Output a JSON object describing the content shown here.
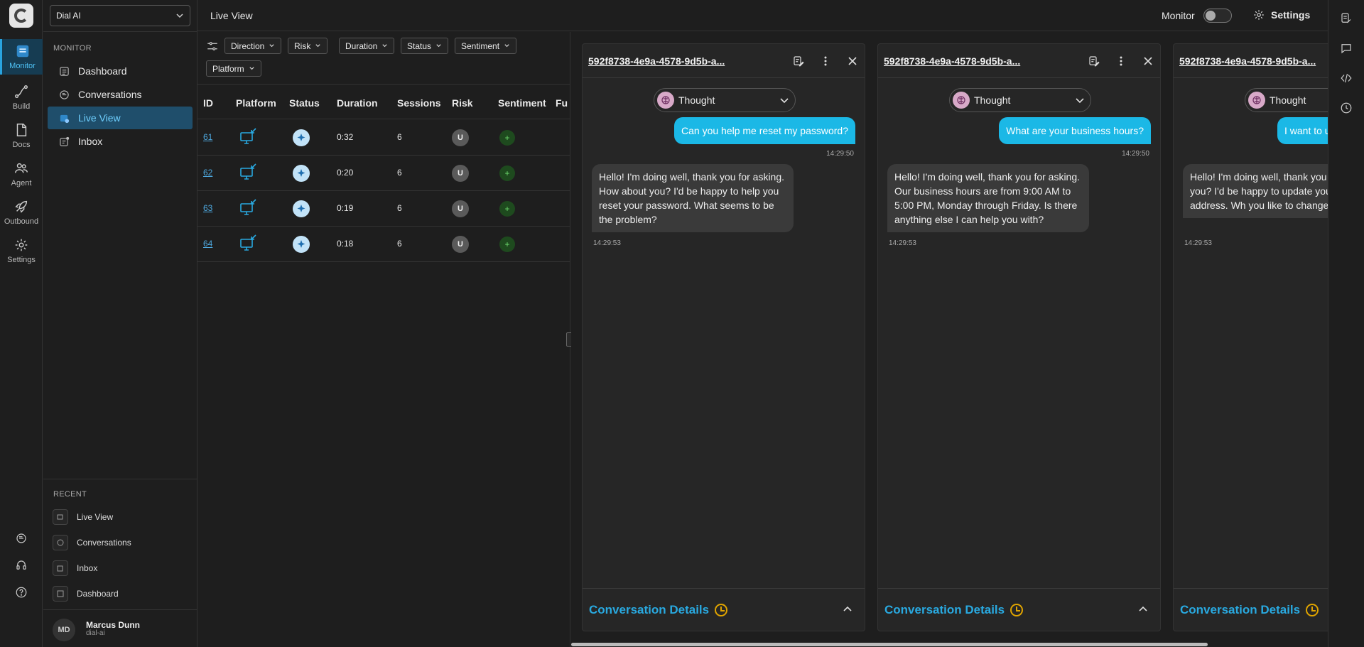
{
  "app": {
    "org": "Dial AI"
  },
  "rail": {
    "items": [
      {
        "label": "Monitor"
      },
      {
        "label": "Build"
      },
      {
        "label": "Docs"
      },
      {
        "label": "Agent"
      },
      {
        "label": "Outbound"
      },
      {
        "label": "Settings"
      }
    ]
  },
  "sidebar": {
    "section": "MONITOR",
    "items": [
      {
        "label": "Dashboard"
      },
      {
        "label": "Conversations"
      },
      {
        "label": "Live View"
      },
      {
        "label": "Inbox"
      }
    ],
    "recent_label": "RECENT",
    "recent": [
      {
        "label": "Live View"
      },
      {
        "label": "Conversations"
      },
      {
        "label": "Inbox"
      },
      {
        "label": "Dashboard"
      }
    ]
  },
  "user": {
    "initials": "MD",
    "name": "Marcus Dunn",
    "org": "dial-ai"
  },
  "header": {
    "title": "Live View",
    "monitor_label": "Monitor",
    "settings_label": "Settings"
  },
  "filters": [
    "Direction",
    "Risk",
    "Duration",
    "Status",
    "Sentiment",
    "Platform"
  ],
  "table": {
    "columns": [
      "ID",
      "Platform",
      "Status",
      "Duration",
      "Sessions",
      "Risk",
      "Sentiment",
      "Fu"
    ],
    "rows": [
      {
        "id": "61",
        "duration": "0:32",
        "sessions": "6",
        "risk": "U",
        "sentiment": "+"
      },
      {
        "id": "62",
        "duration": "0:20",
        "sessions": "6",
        "risk": "U",
        "sentiment": "+"
      },
      {
        "id": "63",
        "duration": "0:19",
        "sessions": "6",
        "risk": "U",
        "sentiment": "+"
      },
      {
        "id": "64",
        "duration": "0:18",
        "sessions": "6",
        "risk": "U",
        "sentiment": "+"
      }
    ]
  },
  "cards": [
    {
      "id": "592f8738-4e9a-4578-9d5b-a...",
      "thought": "Thought",
      "user_msg": "Can you help me reset my password?",
      "user_ts": "14:29:50",
      "bot_msg": "Hello! I'm doing well, thank you for asking. How about you? I'd be happy to help you reset your password. What seems to be the problem?",
      "bot_ts": "14:29:53",
      "details": "Conversation Details"
    },
    {
      "id": "592f8738-4e9a-4578-9d5b-a...",
      "thought": "Thought",
      "user_msg": "What are your business hours?",
      "user_ts": "14:29:50",
      "bot_msg": "Hello! I'm doing well, thank you for asking. Our business hours are from 9:00 AM to 5:00 PM, Monday through Friday. Is there anything else I can help you with?",
      "bot_ts": "14:29:53",
      "details": "Conversation Details"
    },
    {
      "id": "592f8738-4e9a-4578-9d5b-a...",
      "thought": "Thought",
      "user_msg": "I want to u",
      "user_ts": "",
      "bot_msg": "Hello! I'm doing well, thank you How about you? I'd be happy to update your billing address. Wh you like to change it to?",
      "bot_ts": "14:29:53",
      "details": "Conversation Details"
    }
  ]
}
